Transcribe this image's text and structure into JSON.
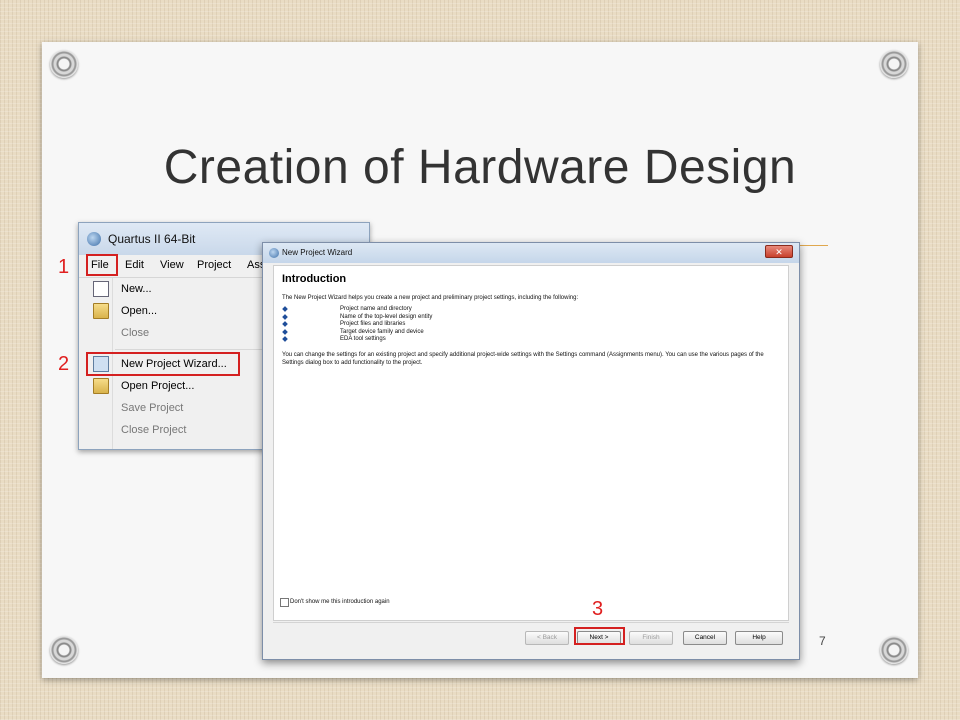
{
  "slide": {
    "title": "Creation of Hardware Design",
    "page_number": "7",
    "markers": [
      "1",
      "2",
      "3"
    ]
  },
  "quartus": {
    "window_title": "Quartus II 64-Bit",
    "menus": [
      "File",
      "Edit",
      "View",
      "Project",
      "Ass"
    ],
    "file_menu_items": [
      {
        "label": "New...",
        "icon": "new-document-icon",
        "enabled": true
      },
      {
        "label": "Open...",
        "icon": "open-folder-icon",
        "enabled": true
      },
      {
        "label": "Close",
        "icon": "",
        "enabled": false
      },
      {
        "label": "New Project Wizard...",
        "icon": "wizard-icon",
        "enabled": true
      },
      {
        "label": "Open Project...",
        "icon": "open-project-icon",
        "enabled": true
      },
      {
        "label": "Save Project",
        "icon": "",
        "enabled": false
      },
      {
        "label": "Close Project",
        "icon": "",
        "enabled": false
      }
    ]
  },
  "wizard": {
    "window_title": "New Project Wizard",
    "close_glyph": "✕",
    "heading": "Introduction",
    "intro": "The New Project Wizard helps you create a new project and preliminary project settings, including the following:",
    "bullets": [
      "Project name and directory",
      "Name of the top-level design entity",
      "Project files and libraries",
      "Target device family and device",
      "EDA tool settings"
    ],
    "outro": "You can change the settings for an existing project and specify additional project-wide settings with the Settings command (Assignments menu). You can use the various pages of the Settings dialog box to add functionality to the project.",
    "checkbox_label": "Don't show me this introduction again",
    "buttons": {
      "back": "< Back",
      "next": "Next >",
      "finish": "Finish",
      "cancel": "Cancel",
      "help": "Help"
    }
  }
}
